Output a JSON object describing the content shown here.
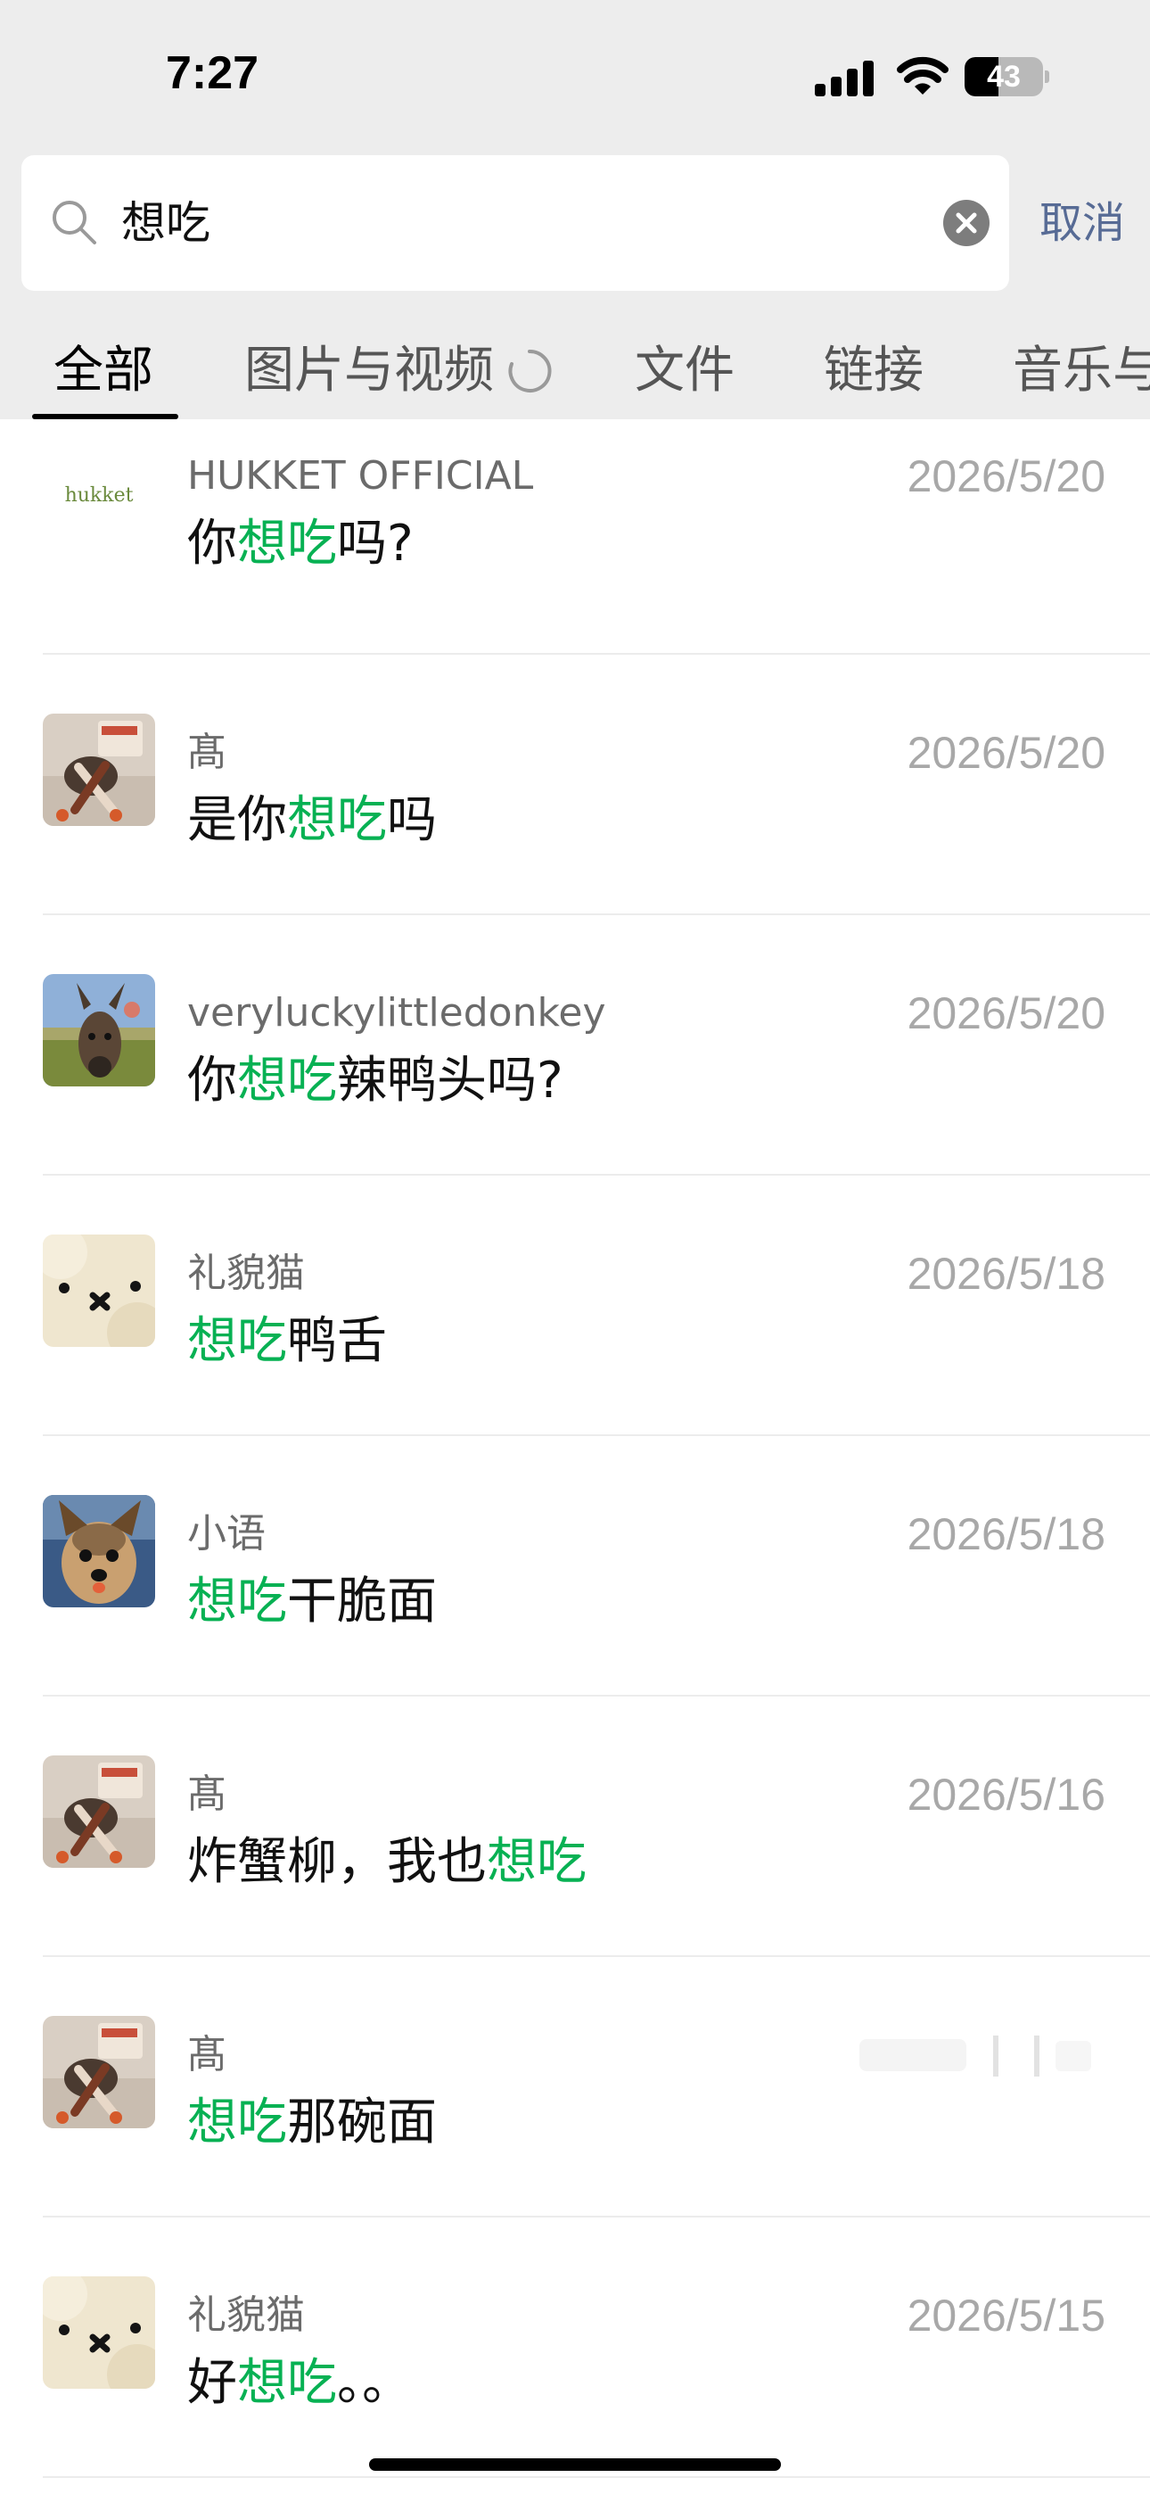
{
  "status_bar": {
    "time": "7:27",
    "battery_level": "43",
    "battery_fraction": 0.43
  },
  "search": {
    "query": "想吃",
    "cancel_label": "取消"
  },
  "tabs": [
    "全部",
    "图片与视频",
    "文件",
    "链接",
    "音乐与"
  ],
  "results": [
    {
      "name": "HUKKET OFFICIAL",
      "date": "2026/5/20",
      "msg": [
        [
          "你",
          false
        ],
        [
          "想吃",
          true
        ],
        [
          "吗?",
          false
        ]
      ],
      "avatar": "logo",
      "avatar_text": "hukket"
    },
    {
      "name": "髙",
      "date": "2026/5/20",
      "msg": [
        [
          "是你",
          false
        ],
        [
          "想吃",
          true
        ],
        [
          "吗",
          false
        ]
      ],
      "avatar": "sleeping-dog"
    },
    {
      "name": "veryluckylittledonkey",
      "date": "2026/5/20",
      "msg": [
        [
          "你",
          false
        ],
        [
          "想吃",
          true
        ],
        [
          "辣鸭头吗?",
          false
        ]
      ],
      "avatar": "donkey"
    },
    {
      "name": "礼貌猫",
      "date": "2026/5/18",
      "msg": [
        [
          "想吃",
          true
        ],
        [
          "鸭舌",
          false
        ]
      ],
      "avatar": "plush"
    },
    {
      "name": "小语",
      "date": "2026/5/18",
      "msg": [
        [
          "想吃",
          true
        ],
        [
          "干脆面",
          false
        ]
      ],
      "avatar": "yorkie"
    },
    {
      "name": "髙",
      "date": "2026/5/16",
      "msg": [
        [
          "炸蟹柳，我也",
          false
        ],
        [
          "想吃",
          true
        ]
      ],
      "avatar": "sleeping-dog"
    },
    {
      "name": "髙",
      "date": "",
      "msg": [
        [
          "想吃",
          true
        ],
        [
          "那碗面",
          false
        ]
      ],
      "avatar": "sleeping-dog"
    },
    {
      "name": "礼貌猫",
      "date": "2026/5/15",
      "msg": [
        [
          "好",
          false
        ],
        [
          "想吃",
          true
        ],
        [
          "。。",
          false
        ]
      ],
      "avatar": "plush"
    }
  ],
  "colors": {
    "highlight": "#07b153",
    "link": "#576b95",
    "header_bg": "#ededed"
  },
  "icons": [
    "signal-icon",
    "wifi-icon",
    "battery-icon",
    "search-icon",
    "clear-icon",
    "loading-icon"
  ]
}
